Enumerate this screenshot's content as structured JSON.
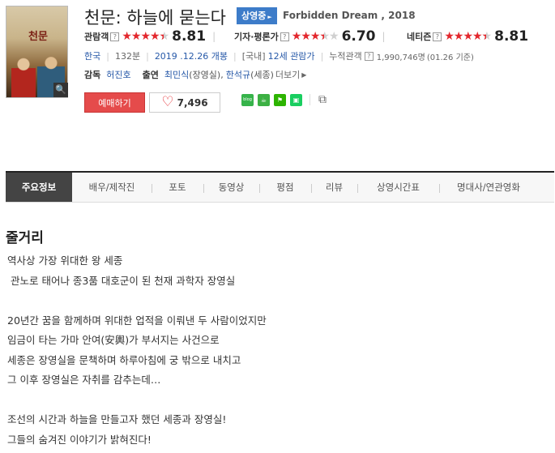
{
  "movie": {
    "poster_title": "천문",
    "title": "천문: 하늘에 묻는다",
    "status_badge": "상영중",
    "english_title": "Forbidden Dream , 2018"
  },
  "ratings": [
    {
      "label": "관람객",
      "help": "?",
      "stars": 4.5,
      "score": "8.81"
    },
    {
      "label": "기자·평론가",
      "help": "?",
      "stars": 3.5,
      "score": "6.70"
    },
    {
      "label": "네티즌",
      "help": "?",
      "stars": 4.5,
      "score": "8.81"
    }
  ],
  "meta": {
    "country": "한국",
    "runtime": "132분",
    "release": "2019 .12.26 개봉",
    "rating_prefix": "[국내]",
    "rating": "12세 관람가",
    "audience_label": "누적관객",
    "audience_help": "?",
    "audience_value": "1,990,746명",
    "audience_date": "(01.26 기준)"
  },
  "credits": {
    "director_label": "감독",
    "director": "허진호",
    "cast_label": "출연",
    "cast1": "최민식",
    "cast1_role": "(장영실),",
    "cast2": "한석규",
    "cast2_role": "(세종)",
    "more": "더보기"
  },
  "actions": {
    "book_label": "예매하기",
    "like_count": "7,496",
    "blog_label": "blog"
  },
  "tabs": [
    {
      "label": "주요정보",
      "active": true
    },
    {
      "label": "배우/제작진"
    },
    {
      "label": "포토"
    },
    {
      "label": "동영상"
    },
    {
      "label": "평점"
    },
    {
      "label": "리뷰"
    },
    {
      "label": "상영시간표"
    },
    {
      "label": "명대사/연관영화"
    }
  ],
  "synopsis": {
    "heading": "줄거리",
    "lines": [
      "역사상 가장 위대한 왕 세종",
      " 관노로 태어나 종3품 대호군이 된 천재 과학자 장영실",
      "",
      "20년간 꿈을 함께하며 위대한 업적을 이뤄낸 두 사람이었지만",
      "임금이 타는 가마 안여(安輿)가 부서지는 사건으로",
      "세종은 장영실을 문책하며 하루아침에 궁 밖으로 내치고",
      "그 이후 장영실은 자취를 감추는데…",
      "",
      "조선의 시간과 하늘을 만들고자 했던 세종과 장영실!",
      "그들의 숨겨진 이야기가 밝혀진다!"
    ]
  },
  "colors": {
    "accent_red": "#e54b4b",
    "badge_blue": "#3d7cc9",
    "link_blue": "#2759a8",
    "star_red": "#e3272d"
  }
}
